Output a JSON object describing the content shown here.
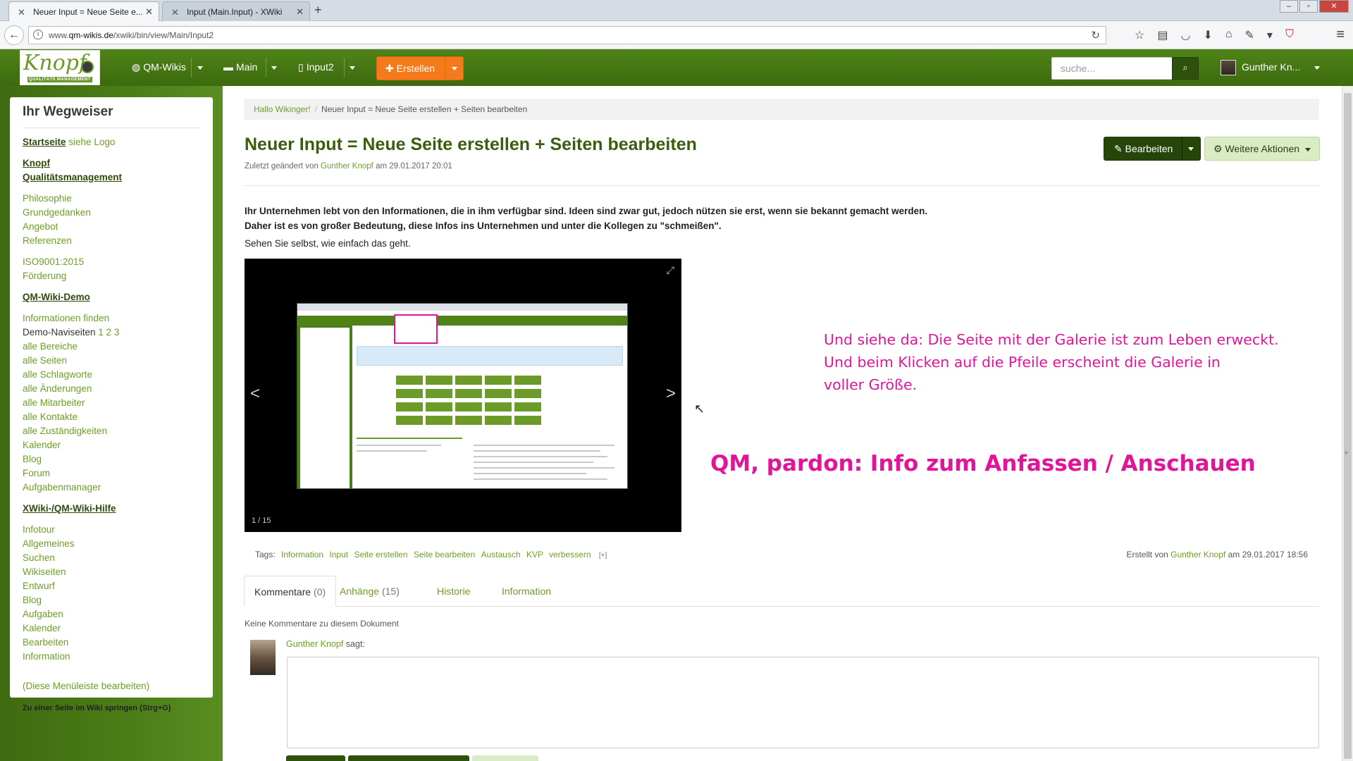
{
  "browser": {
    "tabs": [
      {
        "title": "Neuer Input = Neue Seite e...",
        "active": true
      },
      {
        "title": "Input (Main.Input) - XWiki",
        "active": false
      }
    ],
    "url_prefix": "www.",
    "url_domain": "qm-wikis.de",
    "url_path": "/xwiki/bin/view/Main/Input2"
  },
  "header": {
    "logo_text": "Knopf",
    "logo_subtitle": "QUALITÄTS MANAGEMENT",
    "nav": [
      {
        "label": "QM-Wikis",
        "icon": "globe-icon"
      },
      {
        "label": "Main",
        "icon": "folder-icon"
      },
      {
        "label": "Input2",
        "icon": "file-icon"
      }
    ],
    "create_label": "Erstellen",
    "search_placeholder": "suche...",
    "user_name": "Gunther Kn..."
  },
  "sidebar": {
    "title": "Ihr Wegweiser",
    "start_label": "Startseite",
    "start_hint": "siehe Logo",
    "section1_line1": "Knopf",
    "section1_line2": "Qualitätsmanagement",
    "group1": [
      "Philosophie",
      "Grundgedanken",
      "Angebot",
      "Referenzen"
    ],
    "group2": [
      "ISO9001:2015",
      "Förderung"
    ],
    "section2": "QM-Wiki-Demo",
    "group3_first": "Informationen finden",
    "demo_nav_label": "Demo-Naviseiten",
    "demo_nav_pages": "1 2 3",
    "group3": [
      "alle Bereiche",
      "alle Seiten",
      "alle Schlagworte",
      "alle Änderungen",
      "alle Mitarbeiter",
      "alle Kontakte",
      "alle Zuständigkeiten",
      "Kalender",
      "Blog",
      "Forum",
      "Aufgabenmanager"
    ],
    "section3": "XWiki-/QM-Wiki-Hilfe",
    "group4": [
      "Infotour",
      "Allgemeines",
      "Suchen",
      "Wikiseiten",
      "Entwurf",
      "Blog",
      "Aufgaben",
      "Kalender",
      "Bearbeiten",
      "Information"
    ],
    "edit_menu": "(Diese Menüleiste bearbeiten)",
    "jump": "Zu einer Seite im Wiki springen (Strg+G)"
  },
  "breadcrumb": {
    "home": "Hallo Wikinger!",
    "current": "Neuer Input = Neue Seite erstellen + Seiten bearbeiten"
  },
  "page": {
    "title": "Neuer Input = Neue Seite erstellen + Seiten bearbeiten",
    "meta_prefix": "Zuletzt geändert von",
    "meta_author": "Gunther Knopf",
    "meta_date": "am 29.01.2017 20:01",
    "edit_label": "Bearbeiten",
    "more_label": "Weitere Aktionen",
    "para_line1": "Ihr Unternehmen lebt von den Informationen, die in ihm verfügbar sind. Ideen sind zwar gut, jedoch nützen sie erst, wenn sie bekannt gemacht werden.",
    "para_line2": "Daher ist es von großer Bedeutung, diese Infos ins Unternehmen und unter die Kollegen zu \"schmeißen\".",
    "para2": "Sehen Sie selbst, wie einfach das geht.",
    "gallery_counter": "1 / 15",
    "annotation_line1": "Und siehe da: Die Seite mit der Galerie ist zum Leben erweckt.",
    "annotation_line2": "Und beim Klicken auf die Pfeile erscheint die Galerie in",
    "annotation_line3": "voller Größe.",
    "annotation_big": "QM, pardon: Info zum Anfassen / Anschauen",
    "tags_label": "Tags:",
    "tags": [
      "Information",
      "Input",
      "Seite erstellen",
      "Seite bearbeiten",
      "Austausch",
      "KVP",
      "verbessern"
    ],
    "tags_more": "[+]",
    "created_prefix": "Erstellt von",
    "created_author": "Gunther Knopf",
    "created_date": "am 29.01.2017 18:56"
  },
  "tabs": [
    {
      "label": "Kommentare",
      "count": "(0)"
    },
    {
      "label": "Anhänge",
      "count": "(15)"
    },
    {
      "label": "Historie",
      "count": ""
    },
    {
      "label": "Information",
      "count": ""
    }
  ],
  "comments": {
    "empty": "Keine Kommentare zu diesem Dokument",
    "author": "Gunther Knopf",
    "says": "sagt:"
  },
  "colors": {
    "brand_green": "#4f8417",
    "link_green": "#6d9e25",
    "create_orange": "#f47a1b",
    "annotation_magenta": "#e0169a"
  }
}
